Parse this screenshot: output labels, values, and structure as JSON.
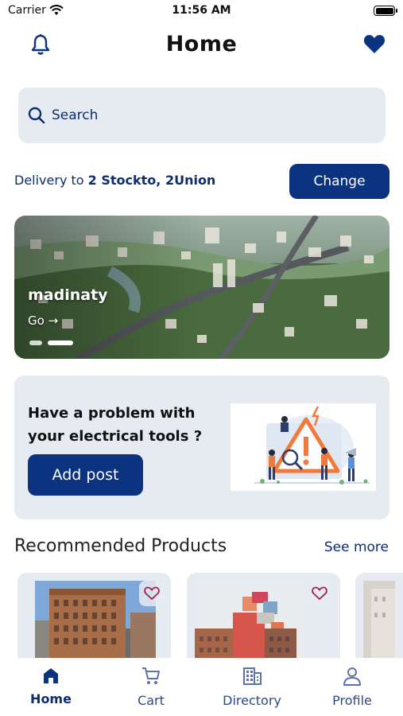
{
  "status_bar": {
    "carrier": "Carrier",
    "time": "11:56 AM"
  },
  "header": {
    "title": "Home",
    "left_icon": "bell-icon",
    "right_icon": "heart-icon"
  },
  "search": {
    "placeholder": "Search"
  },
  "delivery": {
    "prefix": "Delivery to",
    "address": "2 Stockto, 2Union",
    "change_label": "Change"
  },
  "banner": {
    "title": "madinaty",
    "cta": "Go →",
    "slides": 2,
    "active_slide": 2
  },
  "problem_card": {
    "text": "Have a problem with your electrical tools ?",
    "button_label": "Add post"
  },
  "recommended": {
    "title": "Recommended Products",
    "see_more": "See more"
  },
  "tabs": [
    {
      "label": "Home",
      "icon": "home-icon",
      "active": true
    },
    {
      "label": "Cart",
      "icon": "cart-icon",
      "active": false
    },
    {
      "label": "Directory",
      "icon": "building-icon",
      "active": false
    },
    {
      "label": "Profile",
      "icon": "person-icon",
      "active": false
    }
  ],
  "colors": {
    "primary": "#0c3380",
    "text_blue": "#0c2e6e",
    "card_bg": "#e6ebf2"
  }
}
